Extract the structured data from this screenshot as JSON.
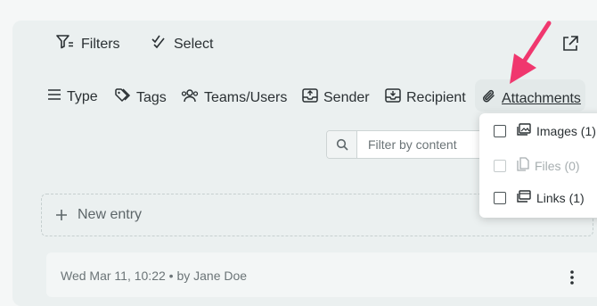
{
  "toolbar": {
    "filters_label": "Filters",
    "select_label": "Select"
  },
  "filter_bar": {
    "type_label": "Type",
    "tags_label": "Tags",
    "teams_label": "Teams/Users",
    "sender_label": "Sender",
    "recipient_label": "Recipient",
    "attachments_label": "Attachments"
  },
  "search": {
    "placeholder": "Filter by content",
    "value": ""
  },
  "attachments_menu": {
    "images_label": "Images (1)",
    "files_label": "Files (0)",
    "links_label": "Links (1)"
  },
  "new_entry": {
    "label": "New entry"
  },
  "entry": {
    "meta": "Wed Mar 11, 10:22 • by Jane Doe"
  },
  "colors": {
    "annotation_arrow": "#f0376e",
    "background": "#ebf0f0"
  }
}
